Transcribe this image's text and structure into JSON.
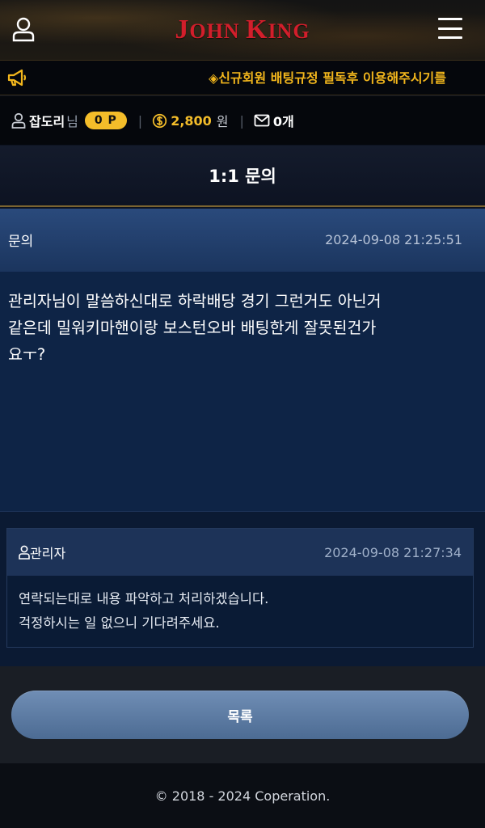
{
  "header": {
    "logo_first_initial": "J",
    "logo_first_rest": "OHN",
    "logo_second_initial": "K",
    "logo_second_rest": "ING",
    "user_icon": "user-icon",
    "menu_icon": "hamburger-menu-icon"
  },
  "notice": {
    "icon": "megaphone-icon",
    "text": "◈신규회원 배팅규정 필독후 이용해주시기를"
  },
  "userbar": {
    "username": "잡도리",
    "username_suffix": "님",
    "points": "0 P",
    "separator": "|",
    "money": "2,800",
    "money_unit": "원",
    "messages": "0개",
    "colors": {
      "accent": "#f4bd2a"
    }
  },
  "page": {
    "title": "1:1 문의"
  },
  "inquiry": {
    "label": "문의",
    "date": "2024-09-08 21:25:51",
    "lines": [
      "관리자님이 말씀하신대로 하락배당 경기 그런거도 아닌거",
      "같은데 밀워키마핸이랑 보스턴오바 배팅한게 잘못된건가",
      "요ㅜ?"
    ]
  },
  "reply": {
    "author": "관리자",
    "date": "2024-09-08 21:27:34",
    "lines": [
      "연락되는대로 내용 파악하고 처리하겠습니다.",
      "걱정하시는 일 없으니 기다려주세요."
    ]
  },
  "actions": {
    "list_label": "목록"
  },
  "footer": {
    "copyright": "© 2018 - 2024 Coperation."
  }
}
